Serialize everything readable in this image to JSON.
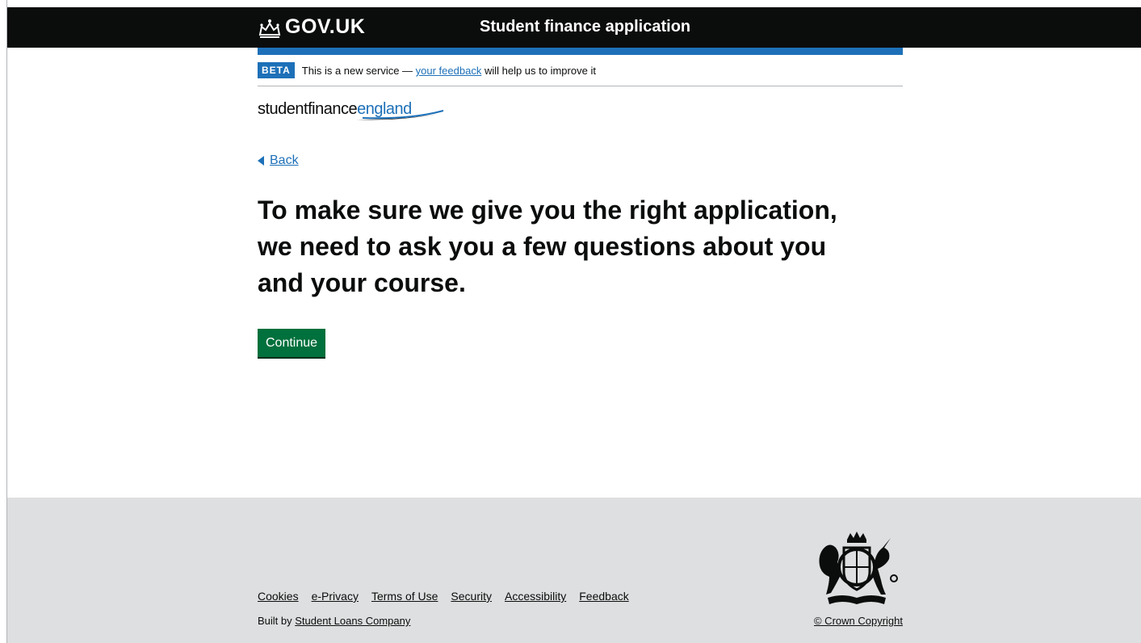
{
  "header": {
    "logo_text": "GOV.UK",
    "service_name": "Student finance application"
  },
  "phase_banner": {
    "tag": "BETA",
    "text_before": "This is a new service — ",
    "link_text": "your feedback",
    "text_after": " will help us to improve it"
  },
  "brand": {
    "part1": "studentfinance",
    "part2": "england"
  },
  "back_link": "Back",
  "main": {
    "heading": "To make sure we give you the right application, we need to ask you a few questions about you and your course.",
    "continue_label": "Continue"
  },
  "footer": {
    "links": [
      "Cookies",
      "e-Privacy",
      "Terms of Use",
      "Security",
      "Accessibility",
      "Feedback"
    ],
    "built_by_prefix": "Built by ",
    "built_by_link": "Student Loans Company",
    "copyright": "© Crown Copyright"
  },
  "colors": {
    "header_bg": "#0b0c0c",
    "brand_blue": "#1d70b8",
    "button_green": "#00703c",
    "footer_bg": "#dedfe0"
  }
}
